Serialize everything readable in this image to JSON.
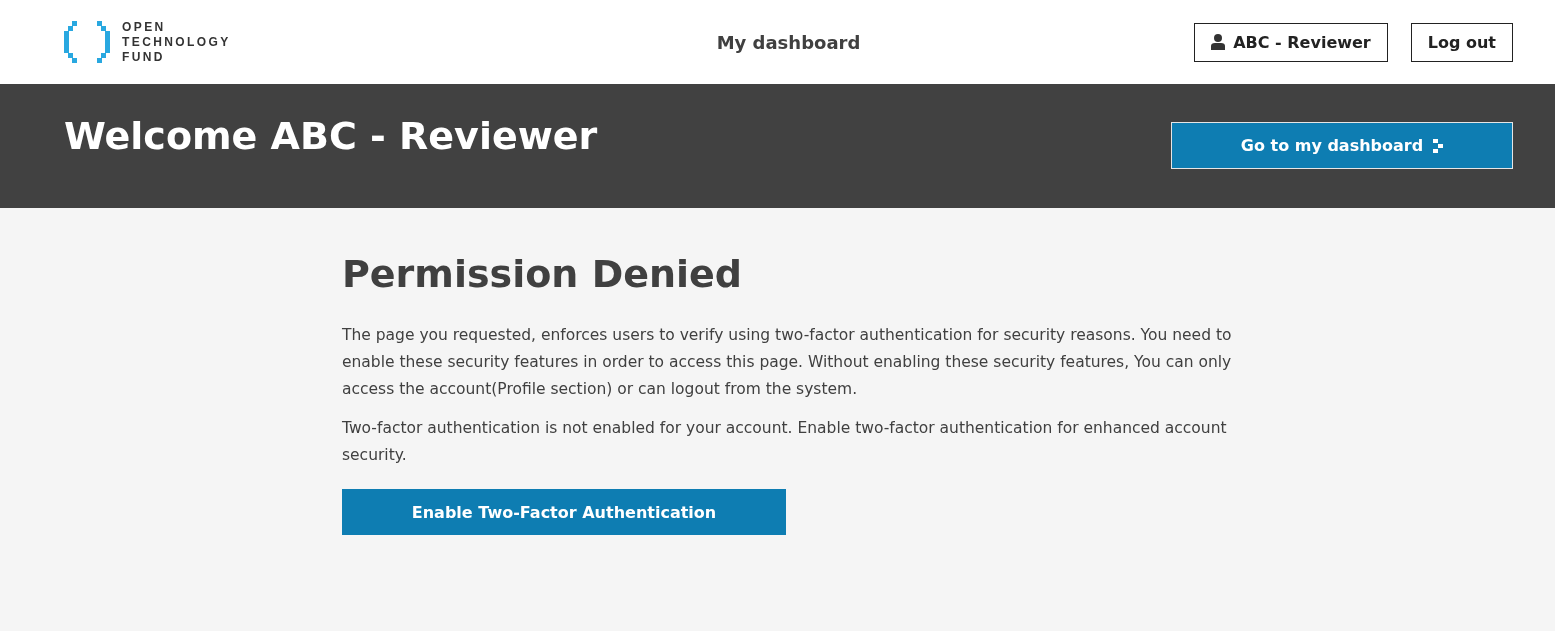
{
  "header": {
    "logo_lines": [
      "OPEN",
      "TECHNOLOGY",
      "FUND"
    ],
    "nav_link": "My dashboard",
    "user_button": "ABC - Reviewer",
    "logout_button": "Log out"
  },
  "banner": {
    "title": "Welcome ABC - Reviewer",
    "button": "Go to my dashboard"
  },
  "content": {
    "heading": "Permission Denied",
    "paragraphs": [
      "The page you requested, enforces users to verify using two-factor authentication for security reasons. You need to enable these security features in order to access this page. Without enabling these security features, You can only access the account(Profile section) or can logout from the system.",
      "Two-factor authentication is not enabled for your account. Enable two-factor authentication for enhanced account security."
    ],
    "button": "Enable Two-Factor Authentication"
  }
}
